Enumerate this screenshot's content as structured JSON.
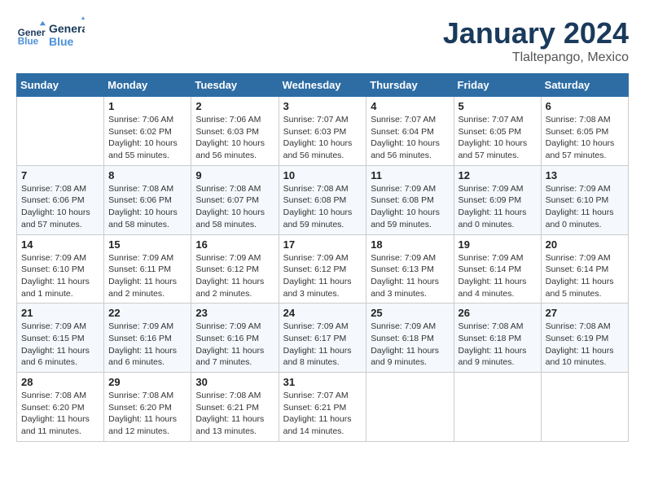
{
  "header": {
    "logo_line1": "General",
    "logo_line2": "Blue",
    "month": "January 2024",
    "location": "Tlaltepango, Mexico"
  },
  "days_of_week": [
    "Sunday",
    "Monday",
    "Tuesday",
    "Wednesday",
    "Thursday",
    "Friday",
    "Saturday"
  ],
  "weeks": [
    [
      {
        "day": "",
        "info": ""
      },
      {
        "day": "1",
        "info": "Sunrise: 7:06 AM\nSunset: 6:02 PM\nDaylight: 10 hours\nand 55 minutes."
      },
      {
        "day": "2",
        "info": "Sunrise: 7:06 AM\nSunset: 6:03 PM\nDaylight: 10 hours\nand 56 minutes."
      },
      {
        "day": "3",
        "info": "Sunrise: 7:07 AM\nSunset: 6:03 PM\nDaylight: 10 hours\nand 56 minutes."
      },
      {
        "day": "4",
        "info": "Sunrise: 7:07 AM\nSunset: 6:04 PM\nDaylight: 10 hours\nand 56 minutes."
      },
      {
        "day": "5",
        "info": "Sunrise: 7:07 AM\nSunset: 6:05 PM\nDaylight: 10 hours\nand 57 minutes."
      },
      {
        "day": "6",
        "info": "Sunrise: 7:08 AM\nSunset: 6:05 PM\nDaylight: 10 hours\nand 57 minutes."
      }
    ],
    [
      {
        "day": "7",
        "info": "Sunrise: 7:08 AM\nSunset: 6:06 PM\nDaylight: 10 hours\nand 57 minutes."
      },
      {
        "day": "8",
        "info": "Sunrise: 7:08 AM\nSunset: 6:06 PM\nDaylight: 10 hours\nand 58 minutes."
      },
      {
        "day": "9",
        "info": "Sunrise: 7:08 AM\nSunset: 6:07 PM\nDaylight: 10 hours\nand 58 minutes."
      },
      {
        "day": "10",
        "info": "Sunrise: 7:08 AM\nSunset: 6:08 PM\nDaylight: 10 hours\nand 59 minutes."
      },
      {
        "day": "11",
        "info": "Sunrise: 7:09 AM\nSunset: 6:08 PM\nDaylight: 10 hours\nand 59 minutes."
      },
      {
        "day": "12",
        "info": "Sunrise: 7:09 AM\nSunset: 6:09 PM\nDaylight: 11 hours\nand 0 minutes."
      },
      {
        "day": "13",
        "info": "Sunrise: 7:09 AM\nSunset: 6:10 PM\nDaylight: 11 hours\nand 0 minutes."
      }
    ],
    [
      {
        "day": "14",
        "info": "Sunrise: 7:09 AM\nSunset: 6:10 PM\nDaylight: 11 hours\nand 1 minute."
      },
      {
        "day": "15",
        "info": "Sunrise: 7:09 AM\nSunset: 6:11 PM\nDaylight: 11 hours\nand 2 minutes."
      },
      {
        "day": "16",
        "info": "Sunrise: 7:09 AM\nSunset: 6:12 PM\nDaylight: 11 hours\nand 2 minutes."
      },
      {
        "day": "17",
        "info": "Sunrise: 7:09 AM\nSunset: 6:12 PM\nDaylight: 11 hours\nand 3 minutes."
      },
      {
        "day": "18",
        "info": "Sunrise: 7:09 AM\nSunset: 6:13 PM\nDaylight: 11 hours\nand 3 minutes."
      },
      {
        "day": "19",
        "info": "Sunrise: 7:09 AM\nSunset: 6:14 PM\nDaylight: 11 hours\nand 4 minutes."
      },
      {
        "day": "20",
        "info": "Sunrise: 7:09 AM\nSunset: 6:14 PM\nDaylight: 11 hours\nand 5 minutes."
      }
    ],
    [
      {
        "day": "21",
        "info": "Sunrise: 7:09 AM\nSunset: 6:15 PM\nDaylight: 11 hours\nand 6 minutes."
      },
      {
        "day": "22",
        "info": "Sunrise: 7:09 AM\nSunset: 6:16 PM\nDaylight: 11 hours\nand 6 minutes."
      },
      {
        "day": "23",
        "info": "Sunrise: 7:09 AM\nSunset: 6:16 PM\nDaylight: 11 hours\nand 7 minutes."
      },
      {
        "day": "24",
        "info": "Sunrise: 7:09 AM\nSunset: 6:17 PM\nDaylight: 11 hours\nand 8 minutes."
      },
      {
        "day": "25",
        "info": "Sunrise: 7:09 AM\nSunset: 6:18 PM\nDaylight: 11 hours\nand 9 minutes."
      },
      {
        "day": "26",
        "info": "Sunrise: 7:08 AM\nSunset: 6:18 PM\nDaylight: 11 hours\nand 9 minutes."
      },
      {
        "day": "27",
        "info": "Sunrise: 7:08 AM\nSunset: 6:19 PM\nDaylight: 11 hours\nand 10 minutes."
      }
    ],
    [
      {
        "day": "28",
        "info": "Sunrise: 7:08 AM\nSunset: 6:20 PM\nDaylight: 11 hours\nand 11 minutes."
      },
      {
        "day": "29",
        "info": "Sunrise: 7:08 AM\nSunset: 6:20 PM\nDaylight: 11 hours\nand 12 minutes."
      },
      {
        "day": "30",
        "info": "Sunrise: 7:08 AM\nSunset: 6:21 PM\nDaylight: 11 hours\nand 13 minutes."
      },
      {
        "day": "31",
        "info": "Sunrise: 7:07 AM\nSunset: 6:21 PM\nDaylight: 11 hours\nand 14 minutes."
      },
      {
        "day": "",
        "info": ""
      },
      {
        "day": "",
        "info": ""
      },
      {
        "day": "",
        "info": ""
      }
    ]
  ]
}
